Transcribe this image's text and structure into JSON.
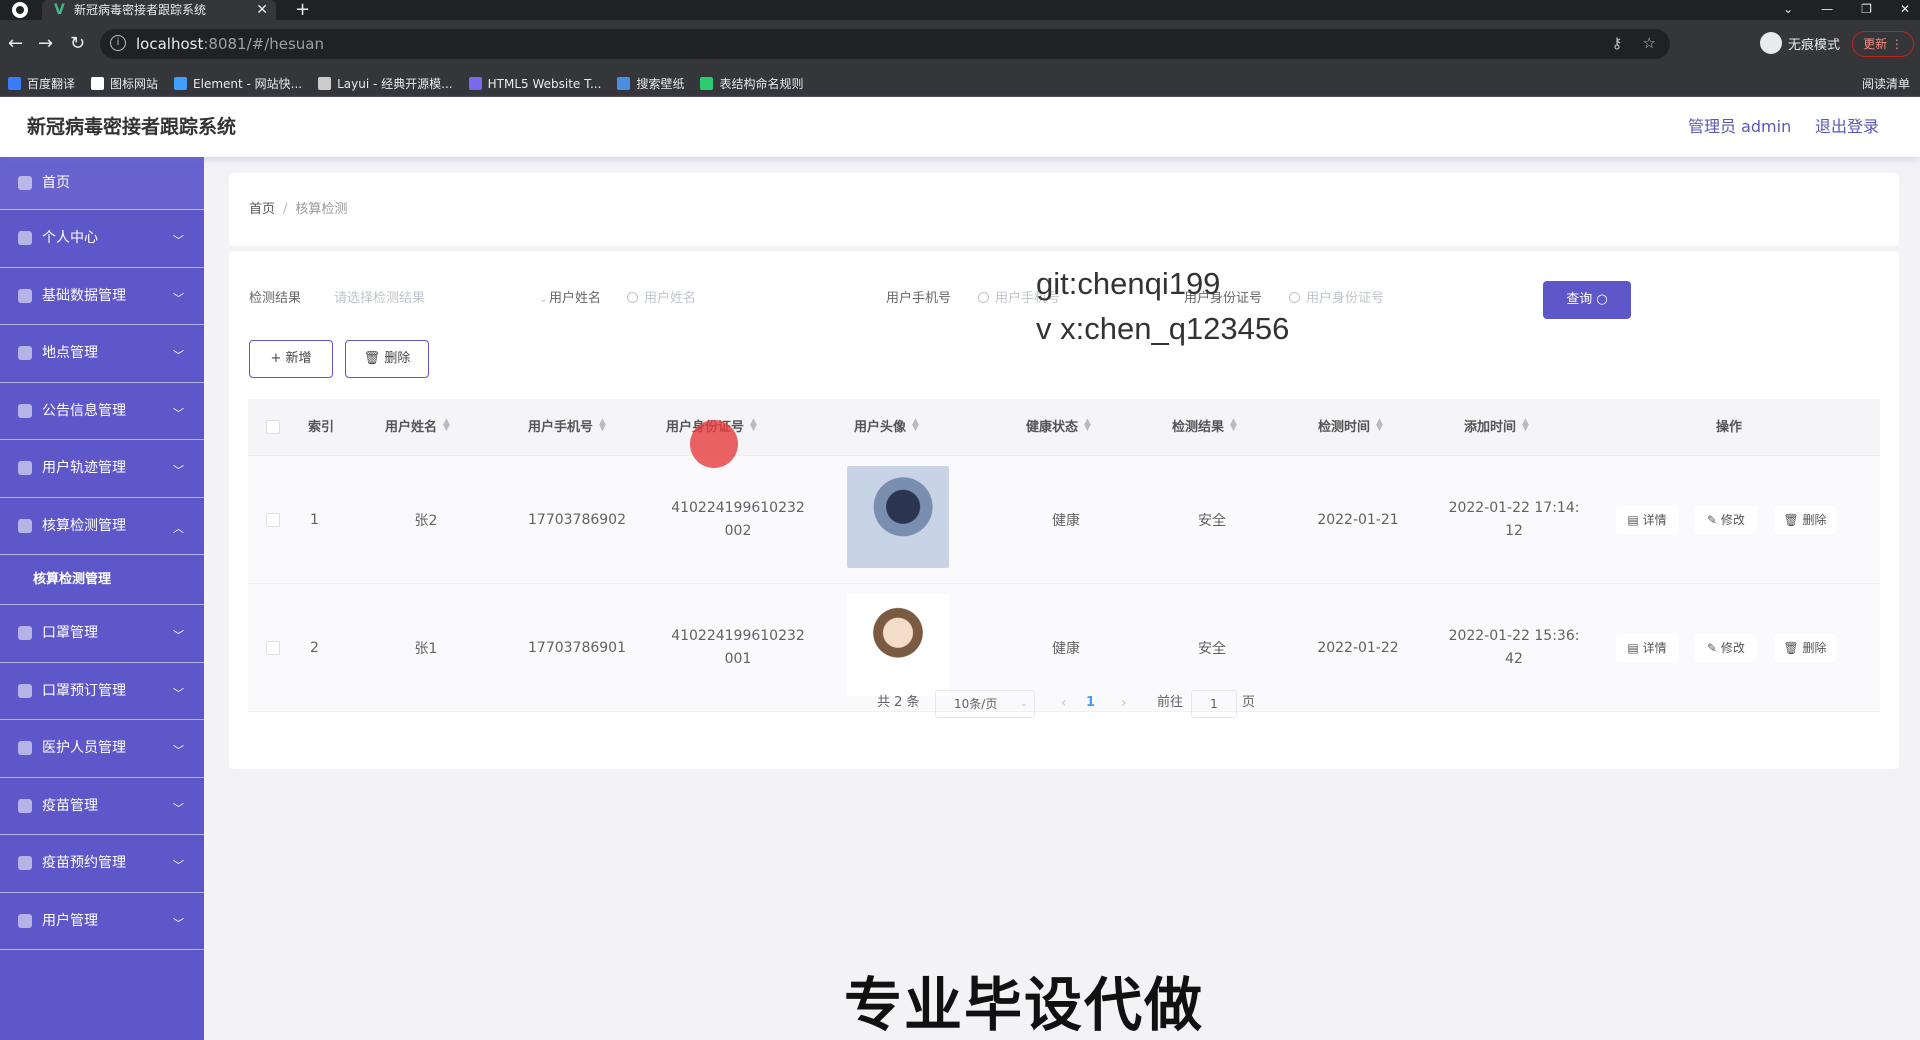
{
  "browser": {
    "tab_title": "新冠病毒密接者跟踪系统",
    "tab_close": "✕",
    "new_tab": "+",
    "url_host": "localhost",
    "url_rest": ":8081/#/hesuan",
    "incognito_label": "无痕模式",
    "update_label": "更新",
    "reading_list": "阅读清单",
    "bookmarks": [
      {
        "label": "百度翻译",
        "color": "#3b7cff"
      },
      {
        "label": "图标网站",
        "color": "#ffffff"
      },
      {
        "label": "Element - 网站快...",
        "color": "#409eff"
      },
      {
        "label": "Layui - 经典开源模...",
        "color": "#cccccc"
      },
      {
        "label": "HTML5 Website T...",
        "color": "#7b68ee"
      },
      {
        "label": "搜索壁纸",
        "color": "#4a90e2"
      },
      {
        "label": "表结构命名规则",
        "color": "#2ecc71"
      }
    ]
  },
  "header": {
    "title": "新冠病毒密接者跟踪系统",
    "admin": "管理员 admin",
    "logout": "退出登录"
  },
  "sidebar": {
    "items": [
      {
        "label": "首页",
        "icon": "home-icon"
      },
      {
        "label": "个人中心",
        "icon": "user-icon"
      },
      {
        "label": "基础数据管理",
        "icon": "list-icon"
      },
      {
        "label": "地点管理",
        "icon": "location-icon"
      },
      {
        "label": "公告信息管理",
        "icon": "notice-icon"
      },
      {
        "label": "用户轨迹管理",
        "icon": "track-icon"
      },
      {
        "label": "核算检测管理",
        "icon": "flag-icon"
      },
      {
        "label": "核算检测管理",
        "icon": ""
      },
      {
        "label": "口罩管理",
        "icon": "mask-icon"
      },
      {
        "label": "口罩预订管理",
        "icon": "order-icon"
      },
      {
        "label": "医护人员管理",
        "icon": "medical-icon"
      },
      {
        "label": "疫苗管理",
        "icon": "chart-icon"
      },
      {
        "label": "疫苗预约管理",
        "icon": "send-icon"
      },
      {
        "label": "用户管理",
        "icon": "users-icon"
      }
    ]
  },
  "breadcrumb": {
    "home": "首页",
    "current": "核算检测"
  },
  "search": {
    "result_label": "检测结果",
    "result_placeholder": "请选择检测结果",
    "name_label": "用户姓名",
    "name_placeholder": "用户姓名",
    "phone_label": "用户手机号",
    "phone_placeholder": "用户手机号",
    "id_label": "用户身份证号",
    "id_placeholder": "用户身份证号",
    "query_button": "查询"
  },
  "actions": {
    "add": "+ 新增",
    "delete": "删除"
  },
  "table": {
    "headers": {
      "index": "索引",
      "name": "用户姓名",
      "phone": "用户手机号",
      "idcard": "用户身份证号",
      "avatar": "用户头像",
      "health": "健康状态",
      "result": "检测结果",
      "test_time": "检测时间",
      "add_time": "添加时间",
      "ops": "操作"
    },
    "rows": [
      {
        "index": "1",
        "name": "张2",
        "phone": "17703786902",
        "idcard_1": "410224199610232",
        "idcard_2": "002",
        "health": "健康",
        "result": "安全",
        "test_time": "2022-01-21",
        "add_time_1": "2022-01-22 17:14:",
        "add_time_2": "12"
      },
      {
        "index": "2",
        "name": "张1",
        "phone": "17703786901",
        "idcard_1": "410224199610232",
        "idcard_2": "001",
        "health": "健康",
        "result": "安全",
        "test_time": "2022-01-22",
        "add_time_1": "2022-01-22 15:36:",
        "add_time_2": "42"
      }
    ],
    "ops": {
      "detail": "详情",
      "edit": "修改",
      "delete": "删除"
    }
  },
  "pagination": {
    "total": "共 2 条",
    "page_size": "10条/页",
    "current": "1",
    "goto": "前往",
    "goto_value": "1",
    "unit": "页"
  },
  "overlay": {
    "line1": "git:chenqi199",
    "line2": "v x:chen_q123456",
    "caption": "专业毕设代做"
  }
}
